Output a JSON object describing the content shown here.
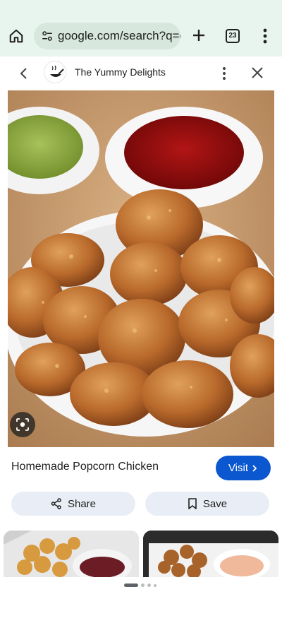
{
  "browser": {
    "url": "google.com/search?q=cl",
    "tab_count": "23",
    "icons": {
      "home": "home-icon",
      "site_settings": "tune-icon",
      "new_tab": "plus-icon",
      "menu": "more-vert-icon"
    }
  },
  "source": {
    "name": "The Yummy Delights"
  },
  "result": {
    "title": "Homemade Popcorn Chicken",
    "visit_label": "Visit",
    "share_label": "Share",
    "save_label": "Save"
  },
  "pager": {
    "page_count": 4,
    "active_index": 0
  },
  "colors": {
    "chrome_bg": "#e8f5ee",
    "urlbar_bg": "#d7e7dd",
    "accent": "#0b57d0",
    "action_bg": "#e9eef6"
  }
}
